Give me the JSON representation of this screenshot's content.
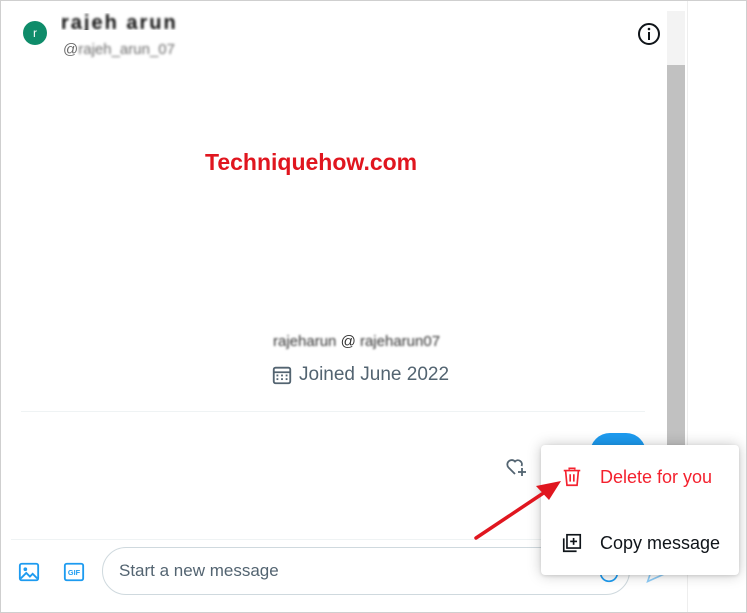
{
  "header": {
    "avatar_initial": "r",
    "display_name": "rajeh arun",
    "handle_prefix": "@",
    "handle_obscured": "rajeh_arun_07",
    "info_icon": "info-circle-icon"
  },
  "watermark": "Techniquehow.com",
  "profile": {
    "handle_obscured": "rajeharun",
    "handle_at": "@",
    "handle_obscured_2": "rajeharun07",
    "joined": "Joined June 2022",
    "calendar_icon": "calendar-icon"
  },
  "context_menu": {
    "delete_label": "Delete for you",
    "copy_label": "Copy message",
    "delete_color": "#f4212e"
  },
  "composer": {
    "placeholder": "Start a new message"
  },
  "colors": {
    "accent": "#1d9bf0",
    "avatar": "#0f8c6a",
    "arrow": "#e0161f"
  }
}
